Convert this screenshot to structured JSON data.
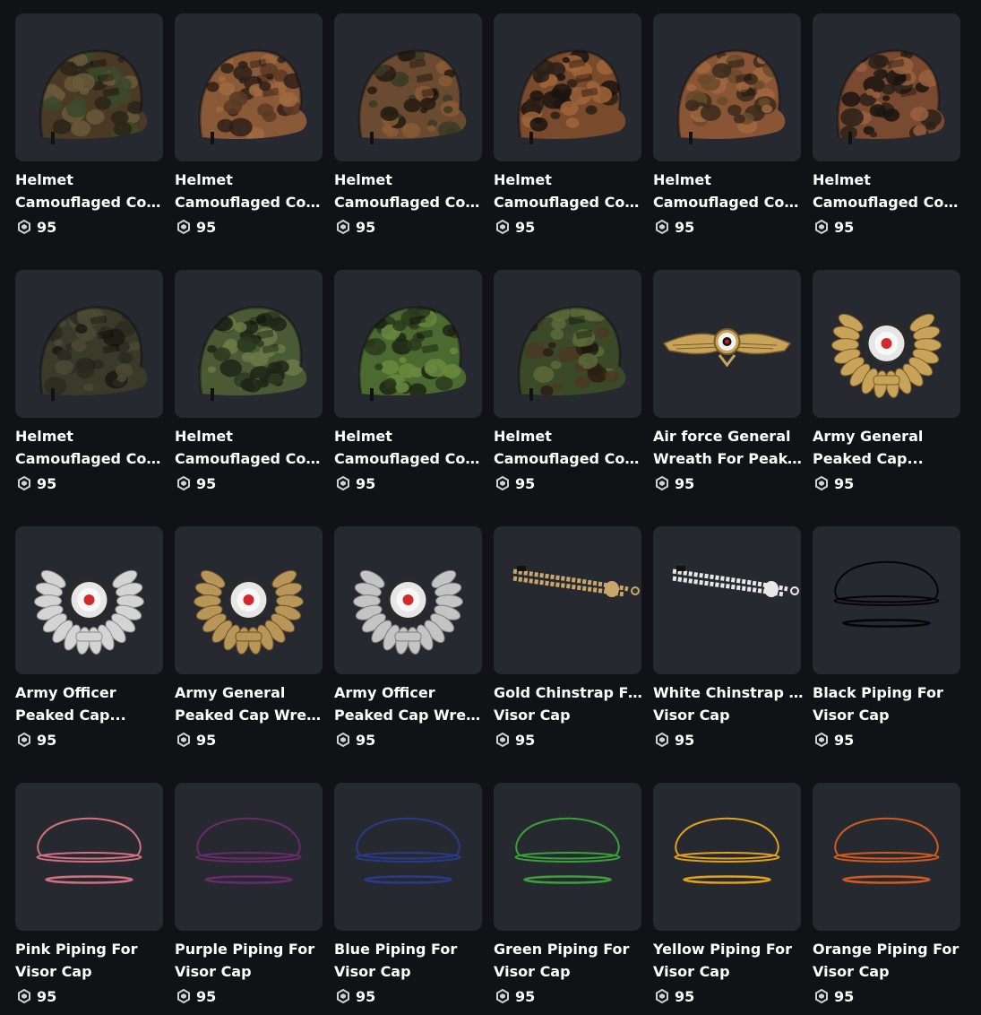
{
  "currency_icon": "robux-icon",
  "items": [
    {
      "line1": "Helmet",
      "line2": "Camouflaged Cove...",
      "price": "95",
      "icon": "helmet-camo-icon",
      "colors": [
        "#4a3a25",
        "#6a5a3a",
        "#3a4a2a",
        "#2a2418"
      ]
    },
    {
      "line1": "Helmet",
      "line2": "Camouflaged Cove...",
      "price": "95",
      "icon": "helmet-camo-icon",
      "colors": [
        "#8a5a38",
        "#5a3a25",
        "#a06a40",
        "#2e2018"
      ]
    },
    {
      "line1": "Helmet",
      "line2": "Camouflaged Cove...",
      "price": "95",
      "icon": "helmet-camo-icon",
      "colors": [
        "#6a4a30",
        "#3a3a25",
        "#8a5a35",
        "#251a12"
      ]
    },
    {
      "line1": "Helmet",
      "line2": "Camouflaged Cove...",
      "price": "95",
      "icon": "helmet-camo-icon",
      "colors": [
        "#7a4a2c",
        "#2a2018",
        "#a0653a",
        "#1a1410"
      ]
    },
    {
      "line1": "Helmet",
      "line2": "Camouflaged Cove...",
      "price": "95",
      "icon": "helmet-camo-icon",
      "colors": [
        "#8a5535",
        "#6a4a2c",
        "#a0683e",
        "#3a2a1c"
      ]
    },
    {
      "line1": "Helmet",
      "line2": "Camouflaged Cove...",
      "price": "95",
      "icon": "helmet-camo-icon",
      "colors": [
        "#7a4a30",
        "#2a2018",
        "#9a6040",
        "#1a1410"
      ]
    },
    {
      "line1": "Helmet",
      "line2": "Camouflaged Cove...",
      "price": "95",
      "icon": "helmet-camo-icon",
      "colors": [
        "#3a3a2a",
        "#2a2a20",
        "#4a4a35",
        "#1a1a14"
      ]
    },
    {
      "line1": "Helmet",
      "line2": "Camouflaged Cove...",
      "price": "95",
      "icon": "helmet-camo-icon",
      "colors": [
        "#4a5a35",
        "#2a3a20",
        "#6a7a45",
        "#1e2418"
      ]
    },
    {
      "line1": "Helmet",
      "line2": "Camouflaged Cove...",
      "price": "95",
      "icon": "helmet-camo-icon",
      "colors": [
        "#4a6a30",
        "#2a3a1c",
        "#6a8a40",
        "#1c2414"
      ]
    },
    {
      "line1": "Helmet",
      "line2": "Camouflaged Cove...",
      "price": "95",
      "icon": "helmet-camo-icon",
      "colors": [
        "#3a4a28",
        "#4a3a22",
        "#5a6a38",
        "#2a1e14"
      ]
    },
    {
      "line1": "Air force General",
      "line2": "Wreath For Peaked...",
      "price": "95",
      "icon": "eagle-insignia-icon",
      "colors": [
        "#c8a45a",
        "#7a5a28"
      ]
    },
    {
      "line1": "Army General",
      "line2": "Peaked Cap...",
      "price": "95",
      "icon": "wreath-badge-icon",
      "colors": [
        "#c8a45a",
        "#7a5a28"
      ]
    },
    {
      "line1": "Army Officer",
      "line2": "Peaked Cap...",
      "price": "95",
      "icon": "wreath-badge-icon",
      "colors": [
        "#d4d4d4",
        "#8a8a8a"
      ]
    },
    {
      "line1": "Army General",
      "line2": "Peaked Cap Wreath",
      "price": "95",
      "icon": "wreath-badge-icon",
      "colors": [
        "#b8965a",
        "#6a5028"
      ]
    },
    {
      "line1": "Army Officer",
      "line2": "Peaked Cap Wreath",
      "price": "95",
      "icon": "wreath-badge-icon",
      "colors": [
        "#c4c4c4",
        "#7a7a7a"
      ]
    },
    {
      "line1": "Gold Chinstrap For",
      "line2": "Visor Cap",
      "price": "95",
      "icon": "chinstrap-icon",
      "colors": [
        "#c8a86a"
      ]
    },
    {
      "line1": "White Chinstrap For",
      "line2": "Visor Cap",
      "price": "95",
      "icon": "chinstrap-icon",
      "colors": [
        "#e8e8e8"
      ]
    },
    {
      "line1": "Black Piping For",
      "line2": "Visor Cap",
      "price": "95",
      "icon": "piping-icon",
      "colors": [
        "#050505"
      ]
    },
    {
      "line1": "Pink Piping For",
      "line2": "Visor Cap",
      "price": "95",
      "icon": "piping-icon",
      "colors": [
        "#d07080"
      ]
    },
    {
      "line1": "Purple Piping For",
      "line2": "Visor Cap",
      "price": "95",
      "icon": "piping-icon",
      "colors": [
        "#6a2a6a"
      ]
    },
    {
      "line1": "Blue Piping For",
      "line2": "Visor Cap",
      "price": "95",
      "icon": "piping-icon",
      "colors": [
        "#2a3a8a"
      ]
    },
    {
      "line1": "Green Piping For",
      "line2": "Visor Cap",
      "price": "95",
      "icon": "piping-icon",
      "colors": [
        "#3aa03a"
      ]
    },
    {
      "line1": "Yellow Piping For",
      "line2": "Visor Cap",
      "price": "95",
      "icon": "piping-icon",
      "colors": [
        "#e0a020"
      ]
    },
    {
      "line1": "Orange Piping For",
      "line2": "Visor Cap",
      "price": "95",
      "icon": "piping-icon",
      "colors": [
        "#d05a20"
      ]
    }
  ]
}
